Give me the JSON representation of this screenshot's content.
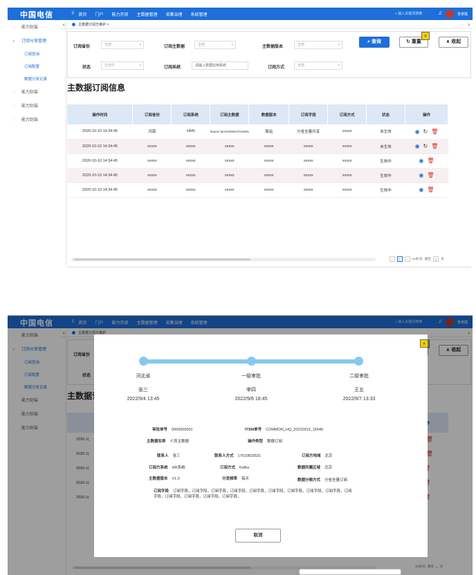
{
  "header": {
    "logo": "中国电信",
    "logo_en": "CHINA TELECOM",
    "nav": [
      "首页",
      "门户",
      "能力开放",
      "主数据管理",
      "采集治理",
      "系统管理"
    ],
    "search_placeholder": "输入关键词搜索",
    "user": "李翠霞"
  },
  "sidebar": {
    "items": [
      {
        "label": "能力封装"
      },
      {
        "label": "订阅分发管理",
        "active": true
      },
      {
        "label": "能力封装"
      },
      {
        "label": "能力封装"
      },
      {
        "label": "能力封装"
      }
    ],
    "sub": [
      "订阅查询",
      "订阅配置",
      "数据分发记录"
    ]
  },
  "tab": {
    "label": "主数据订阅方维护"
  },
  "filters": {
    "province_label": "订阅省份",
    "province_value": "全部",
    "master_label": "订阅主数据",
    "master_value": "全部",
    "version_label": "主数据版本",
    "version_value": "全部",
    "status_label": "状态",
    "status_value": "生效中",
    "system_label": "订阅系统",
    "system_placeholder": "请输入数据应用系统",
    "method_label": "订阅方式",
    "method_value": "全部"
  },
  "buttons": {
    "query": "查询",
    "reset": "重置",
    "collapse": "收起",
    "cancel": "取消"
  },
  "section_title": "主数据订阅信息",
  "table": {
    "headers": [
      "操作时间",
      "订阅省份",
      "订阅系统",
      "订阅主数据",
      "数据版本",
      "订阅字段",
      "订阅方式",
      "状态",
      "操作"
    ],
    "rows": [
      [
        "2020-10-10 14:34:45",
        "河南",
        "HNN",
        "/bossr/ MASTERDATA/HNN",
        "局站",
        "分省全量共享",
        "xxxxx",
        "未生效"
      ],
      [
        "2020-10-10 14:34:45",
        "xxxxx",
        "xxxxx",
        "xxxxx",
        "xxxxx",
        "xxxxx",
        "xxxxx",
        "未生效"
      ],
      [
        "2020-10-10 14:34:45",
        "xxxxx",
        "xxxxx",
        "xxxxx",
        "xxxxx",
        "xxxxx",
        "xxxxx",
        "生效中"
      ],
      [
        "2020-10-10 14:34:45",
        "xxxxx",
        "xxxxx",
        "xxxxx",
        "xxxxx",
        "xxxxx",
        "xxxxx",
        "生效中"
      ],
      [
        "2020-10-10 14:34:45",
        "xxxxx",
        "xxxxx",
        "xxxxx",
        "xxxxx",
        "xxxxx",
        "xxxxx",
        "生效中"
      ]
    ]
  },
  "pager": {
    "page": "1",
    "per_page": "10条/页",
    "goto": "跳至",
    "page_unit": "页"
  },
  "modal": {
    "steps": [
      {
        "title": "河北省",
        "person": "张三",
        "time": "2022/9/4 13:45"
      },
      {
        "title": "一级审批",
        "person": "李四",
        "time": "2022/9/6 18:45"
      },
      {
        "title": "二级审批",
        "person": "王五",
        "time": "2022/9/7 13:33"
      }
    ],
    "fields": {
      "approval_no_label": "审批单号",
      "approval_no": "0000000001",
      "itsm_label": "ITSM单号",
      "itsm": "COMMON_HQ_20210915_16548",
      "master_name_label": "主数据名称",
      "master_name": "人员主数据",
      "op_type_label": "操作类型",
      "op_type": "数据订阅",
      "contact_label": "联系人",
      "contact": "张三",
      "contact_way_label": "联系人方式",
      "contact_way": "17610833531",
      "sub_area_label": "订阅方地域",
      "sub_area": "北京",
      "sub_system_label": "订阅方系统",
      "sub_system": "HR系统",
      "sub_method_label": "订阅方式",
      "sub_method": "Kafka",
      "data_area_label": "数据所属区域",
      "data_area": "北京",
      "version_label": "主数据版本",
      "version": "V1.0",
      "freq_label": "分发频率",
      "freq": "每天",
      "dist_label": "数据分频方式",
      "dist": "分省全量订阅",
      "fields_label": "订阅字段",
      "fields_value": "订阅字段，订阅字段，订阅字段，订阅字段，订阅字段，订阅字段，订阅字段，订阅字段，订阅字段，订阅字段，订阅字段，订阅字段，订阅字段，订阅字段，"
    }
  }
}
